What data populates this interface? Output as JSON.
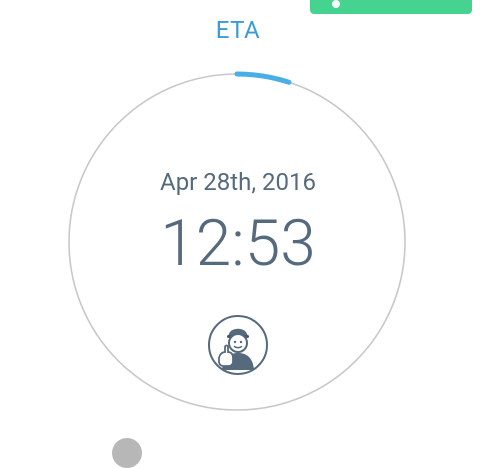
{
  "header": {
    "title": "ETA"
  },
  "eta": {
    "date": "Apr 28th, 2016",
    "time": "12:53",
    "progress_fraction": 0.05
  },
  "icons": {
    "avatar": "worker-thumbs-up-icon"
  },
  "colors": {
    "accent_blue": "#3a9bd8",
    "progress_blue": "#4aaee6",
    "ring_gray": "#c8c8c8",
    "text_slate": "#566a7d",
    "action_green": "#45d38f"
  }
}
